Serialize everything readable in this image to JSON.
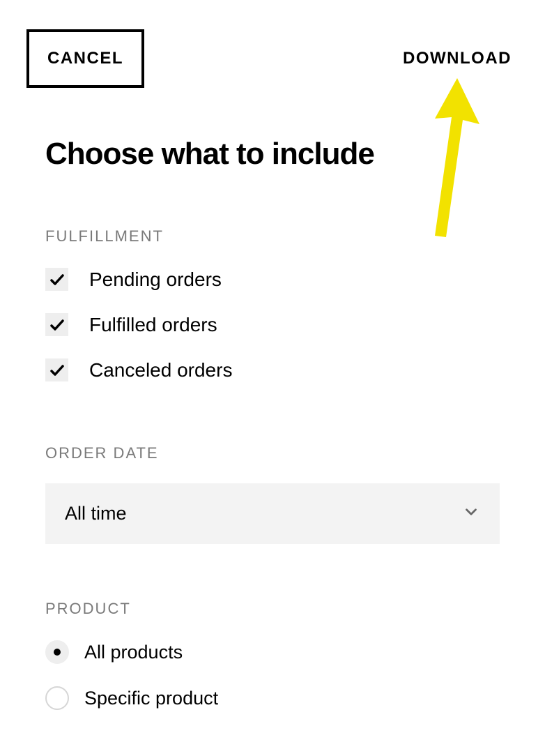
{
  "header": {
    "cancel_label": "CANCEL",
    "download_label": "DOWNLOAD"
  },
  "title": "Choose what to include",
  "fulfillment": {
    "label": "FULFILLMENT",
    "options": [
      {
        "label": "Pending orders",
        "checked": true
      },
      {
        "label": "Fulfilled orders",
        "checked": true
      },
      {
        "label": "Canceled orders",
        "checked": true
      }
    ]
  },
  "order_date": {
    "label": "ORDER DATE",
    "selected": "All time"
  },
  "product": {
    "label": "PRODUCT",
    "options": [
      {
        "label": "All products",
        "selected": true
      },
      {
        "label": "Specific product",
        "selected": false
      }
    ]
  }
}
